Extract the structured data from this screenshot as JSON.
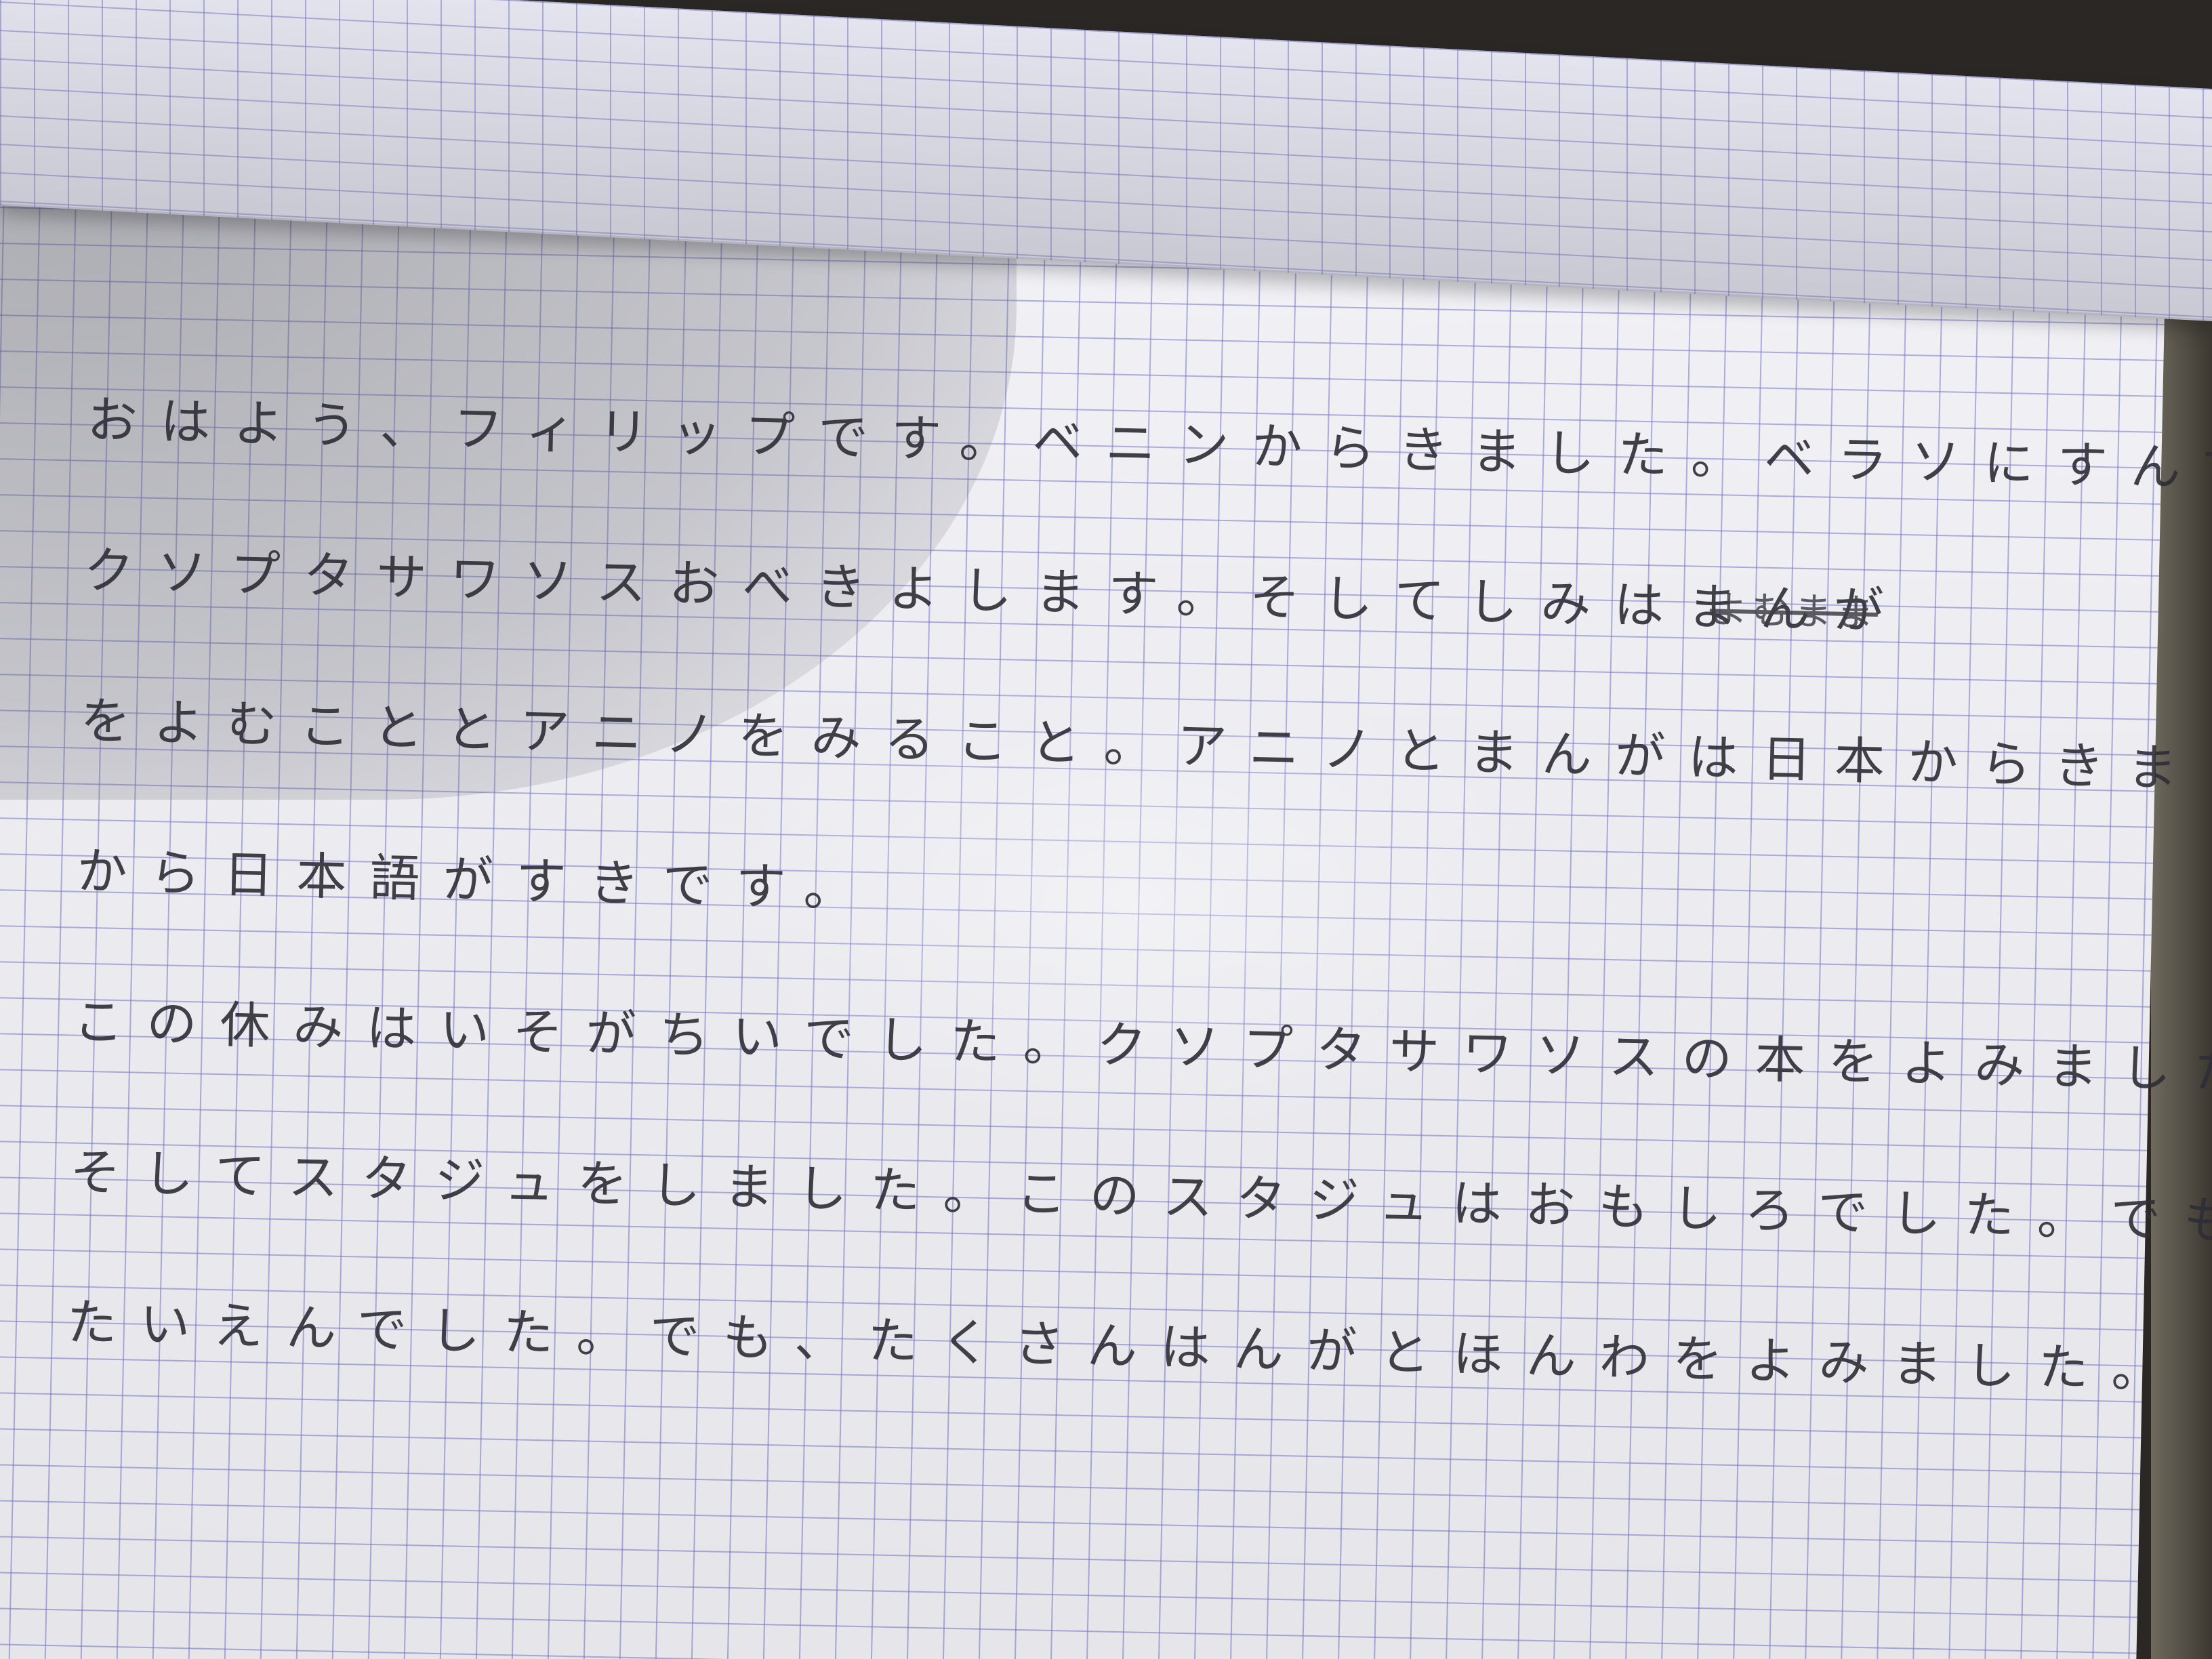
{
  "notebook": {
    "lines": [
      "おはよう、フィリップです。ベニンからきました。ベラソにすんでいます。",
      "クソプタサワソスおべきよします。そしてしみはまんが",
      "をよむこととアニノをみること。アニノとまんがは日本からきました、",
      "から日本語がすきです。",
      "この休みはいそがちいでした。クソプタサワソスの本をよみました、",
      "そしてスタジュをしました。このスタジュはおもしろでした。でもすこち",
      "たいえんでした。でも、たくさんはんがとほんわをよみました。"
    ],
    "struck_text": "よむまま"
  }
}
